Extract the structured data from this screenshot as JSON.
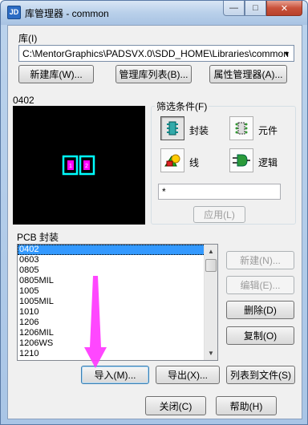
{
  "window": {
    "title": "库管理器 - common",
    "icon_text": "JD",
    "minimize_glyph": "—",
    "maximize_glyph": "□",
    "close_glyph": "✕"
  },
  "library": {
    "label": "库(I)",
    "path": "C:\\MentorGraphics\\PADSVX.0\\SDD_HOME\\Libraries\\common"
  },
  "top_buttons": {
    "new_library": "新建库(W)...",
    "manage_library_list": "管理库列表(B)...",
    "attribute_manager": "属性管理器(A)..."
  },
  "preview": {
    "label": "0402",
    "pad1": "1",
    "pad2": "2",
    "outline_color": "#00ffff",
    "pad_color": "#ff00ff"
  },
  "filter": {
    "legend": "筛选条件(F)",
    "decal_label": "封装",
    "part_label": "元件",
    "line_label": "线",
    "logic_label": "逻辑",
    "filter_text": "*",
    "apply_label": "应用(L)"
  },
  "list": {
    "label": "PCB 封装",
    "items": [
      "0402",
      "0603",
      "0805",
      "0805MIL",
      "1005",
      "1005MIL",
      "1010",
      "1206",
      "1206MIL",
      "1206WS",
      "1210"
    ],
    "selected_index": 0
  },
  "side_buttons": {
    "new": "新建(N)...",
    "edit": "编辑(E)...",
    "delete": "删除(D)",
    "copy": "复制(O)"
  },
  "bottom_buttons": {
    "import": "导入(M)...",
    "export": "导出(X)...",
    "list_to_file": "列表到文件(S)"
  },
  "dialog_buttons": {
    "close": "关闭(C)",
    "help": "帮助(H)"
  },
  "accent_colors": {
    "selection": "#3399ff",
    "annotation_arrow": "#ff33ff"
  }
}
